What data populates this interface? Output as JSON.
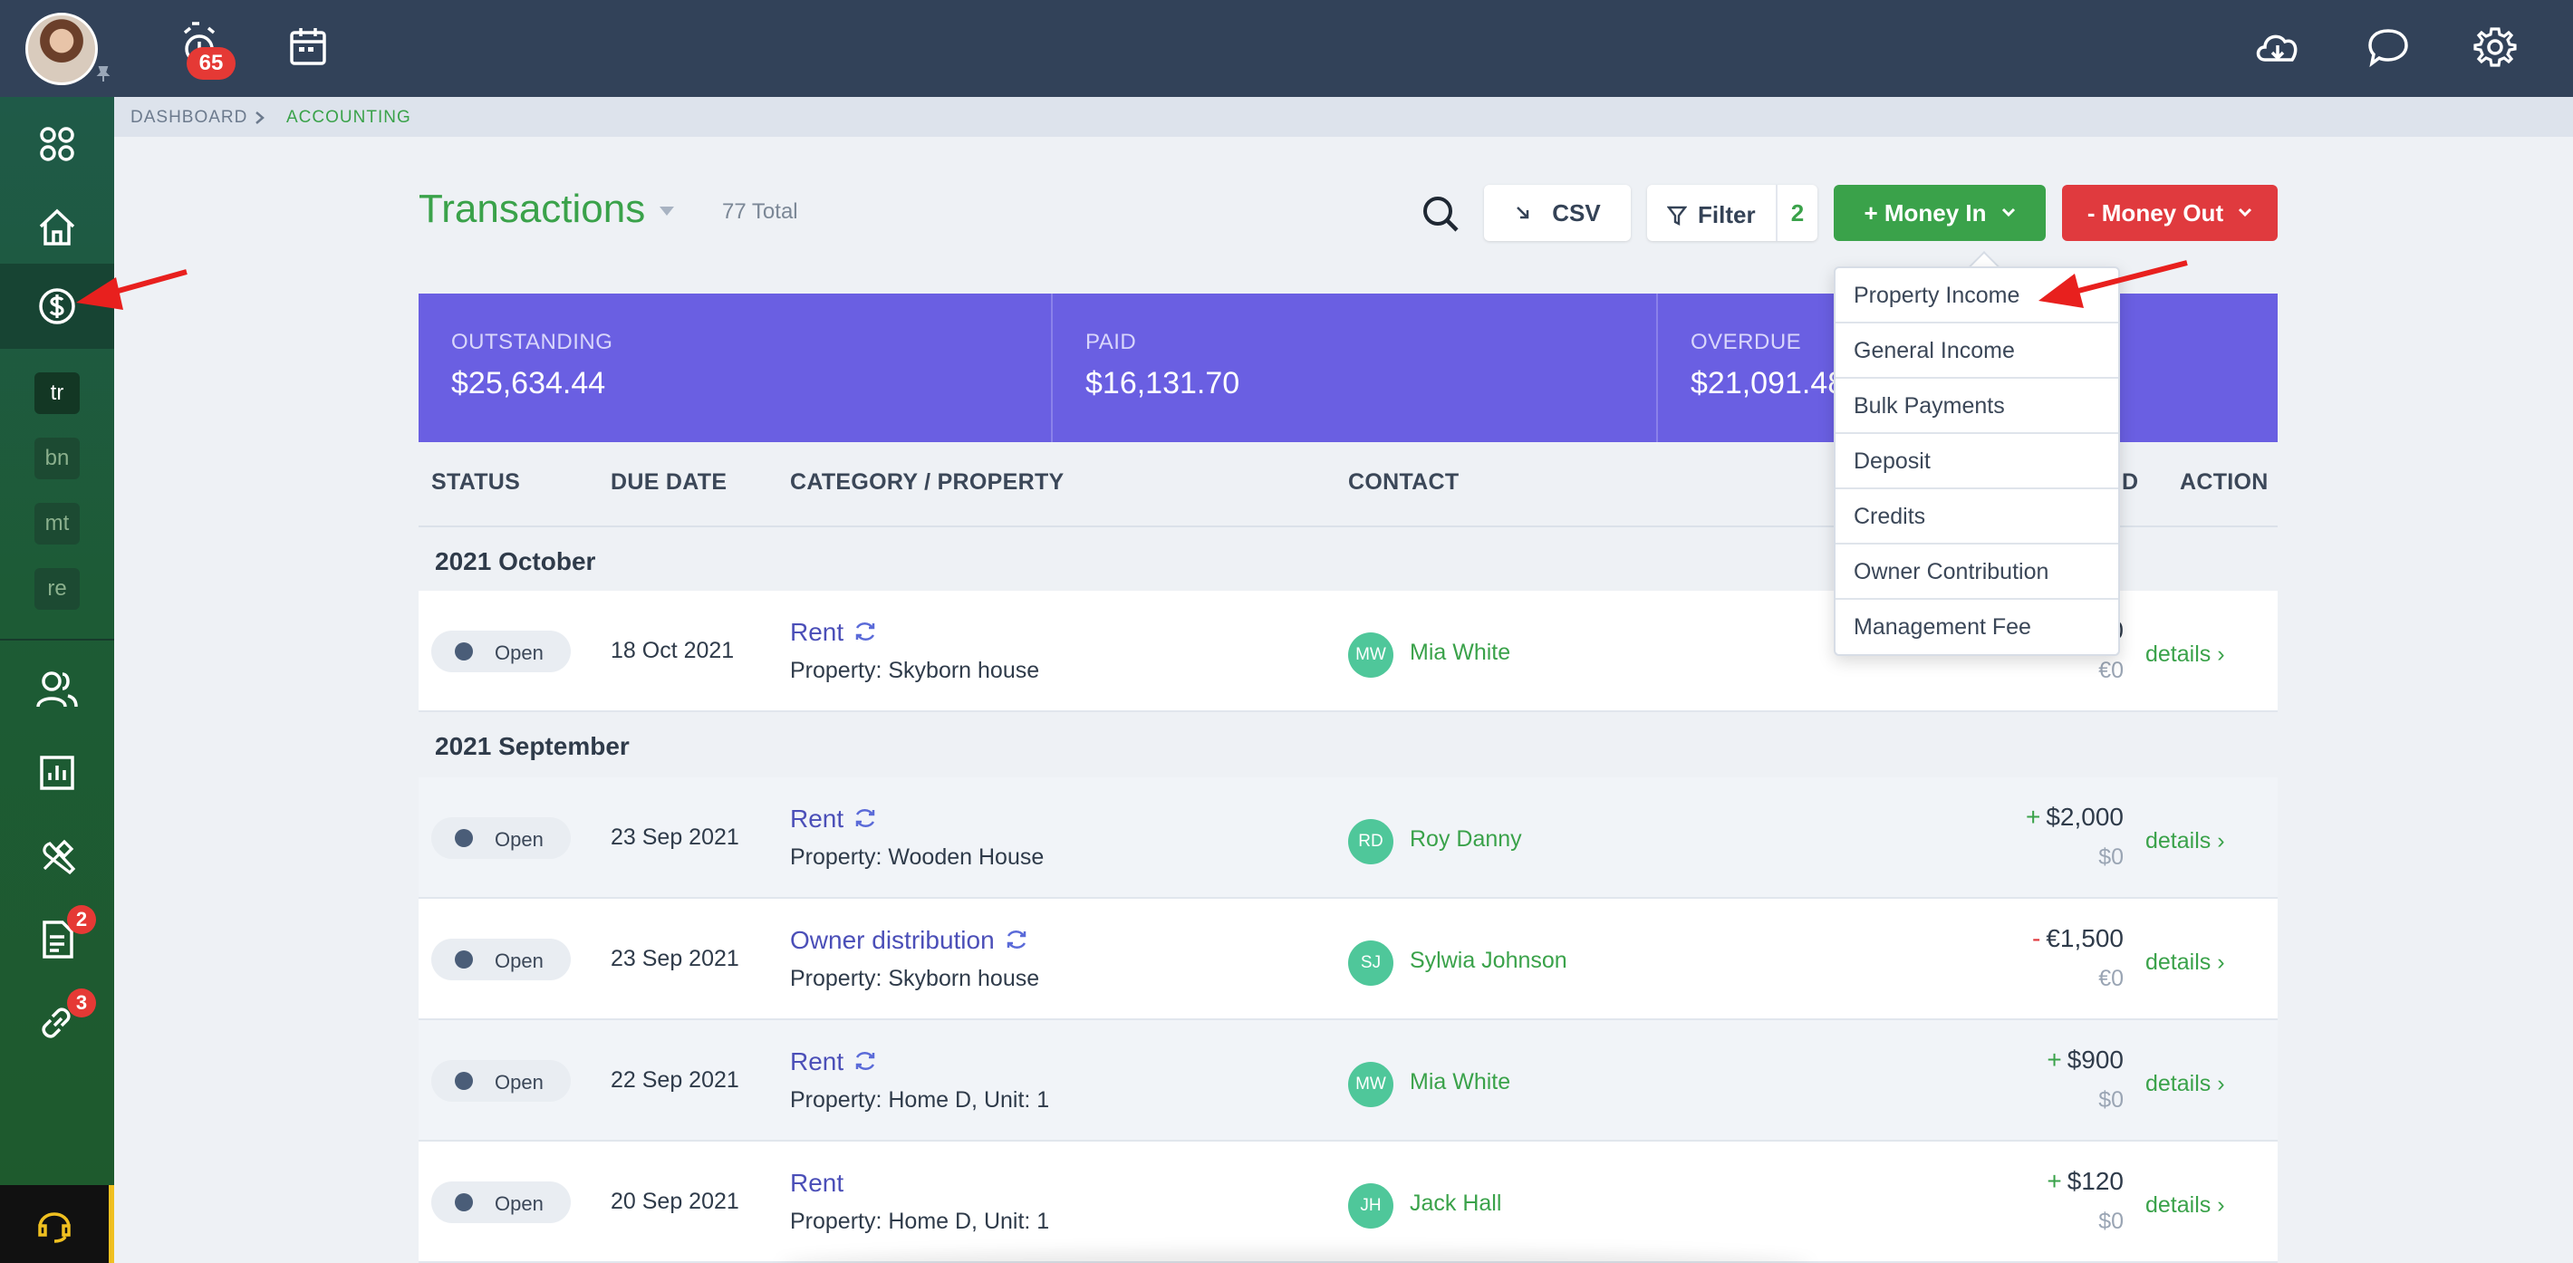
{
  "topbar": {
    "notification_count": "65",
    "icons": [
      "avatar",
      "pin-icon",
      "alarm-icon",
      "calendar-icon",
      "cloud-download-icon",
      "chat-icon",
      "gear-icon"
    ]
  },
  "sidebar": {
    "items": [
      {
        "name": "apps-icon"
      },
      {
        "name": "home-icon"
      },
      {
        "name": "accounting-dollar-icon",
        "active": true
      },
      {
        "name": "contacts-icon"
      },
      {
        "name": "reports-icon"
      },
      {
        "name": "maintenance-tools-icon"
      },
      {
        "name": "documents-icon",
        "badge": "2"
      },
      {
        "name": "links-icon",
        "badge": "3"
      }
    ],
    "sub_items": [
      "tr",
      "bn",
      "mt",
      "re"
    ],
    "support_icon": "headset-icon"
  },
  "breadcrumb": {
    "home": "DASHBOARD",
    "current": "ACCOUNTING"
  },
  "page": {
    "title": "Transactions",
    "total": "77 Total",
    "csv_label": "CSV",
    "filter_label": "Filter",
    "filter_count": "2",
    "money_in_label": "+ Money In",
    "money_out_label": "- Money Out"
  },
  "summary": {
    "outstanding_label": "OUTSTANDING",
    "outstanding_value": "$25,634.44",
    "paid_label": "PAID",
    "paid_value": "$16,131.70",
    "overdue_label": "OVERDUE",
    "overdue_value": "$21,091.48"
  },
  "table": {
    "headers": {
      "status": "STATUS",
      "due_date": "DUE DATE",
      "category": "CATEGORY / PROPERTY",
      "contact": "CONTACT",
      "paid": "D",
      "action": "ACTION"
    },
    "groups": [
      {
        "label": "2021 October",
        "rows": [
          {
            "status": "Open",
            "due": "18 Oct 2021",
            "category": "Rent",
            "recurring": true,
            "property": "Property: Skyborn house",
            "initials": "MW",
            "contact": "Mia White",
            "sign": "",
            "amount": "0",
            "balance": "€0",
            "action": "details"
          }
        ]
      },
      {
        "label": "2021 September",
        "rows": [
          {
            "status": "Open",
            "due": "23 Sep 2021",
            "category": "Rent",
            "recurring": true,
            "property": "Property: Wooden House",
            "initials": "RD",
            "contact": "Roy Danny",
            "sign": "+",
            "amount": "$2,000",
            "balance": "$0",
            "action": "details"
          },
          {
            "status": "Open",
            "due": "23 Sep 2021",
            "category": "Owner distribution",
            "recurring": true,
            "property": "Property: Skyborn house",
            "initials": "SJ",
            "contact": "Sylwia Johnson",
            "sign": "-",
            "amount": "€1,500",
            "balance": "€0",
            "action": "details"
          },
          {
            "status": "Open",
            "due": "22 Sep 2021",
            "category": "Rent",
            "recurring": true,
            "property": "Property: Home D, Unit: 1",
            "initials": "MW",
            "contact": "Mia White",
            "sign": "+",
            "amount": "$900",
            "balance": "$0",
            "action": "details"
          },
          {
            "status": "Open",
            "due": "20 Sep 2021",
            "category": "Rent",
            "recurring": false,
            "property": "Property: Home D, Unit: 1",
            "initials": "JH",
            "contact": "Jack Hall",
            "sign": "+",
            "amount": "$120",
            "balance": "$0",
            "action": "details"
          }
        ]
      }
    ]
  },
  "money_in_menu": {
    "items": [
      "Property Income",
      "General Income",
      "Bulk Payments",
      "Deposit",
      "Credits",
      "Owner Contribution",
      "Management Fee"
    ]
  },
  "colors": {
    "topbar": "#324259",
    "sidebar": "#1d5b35",
    "accent_green": "#3aa24a",
    "accent_red": "#e03a3e",
    "summary_band": "#6a5fe2",
    "link_purple": "#4b4fb8",
    "annotation_arrow": "#e8201e"
  }
}
